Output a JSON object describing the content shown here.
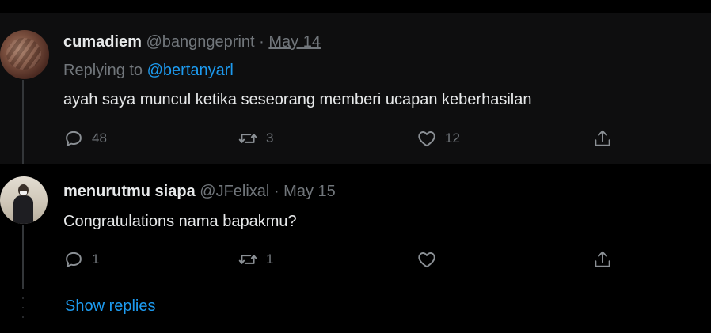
{
  "tweets": [
    {
      "display_name": "cumadiem",
      "handle": "@bangngeprint",
      "separator": "·",
      "date": "May 14",
      "replying_prefix": "Replying to",
      "replying_mention": "@bertanyarl",
      "text": "ayah saya muncul ketika seseorang memberi ucapan keberhasilan",
      "replies": "48",
      "retweets": "3",
      "likes": "12"
    },
    {
      "display_name": "menurutmu siapa",
      "handle": "@JFelixal",
      "separator": "·",
      "date": "May 15",
      "text": "Congratulations nama bapakmu?",
      "replies": "1",
      "retweets": "1",
      "likes": ""
    }
  ],
  "show_replies_label": "Show replies",
  "icons": {
    "reply": "reply-icon",
    "retweet": "retweet-icon",
    "like": "heart-icon",
    "share": "share-icon"
  },
  "colors": {
    "background": "#000000",
    "accent": "#1d9bf0",
    "muted": "#71767b",
    "text": "#e7e9ea"
  }
}
